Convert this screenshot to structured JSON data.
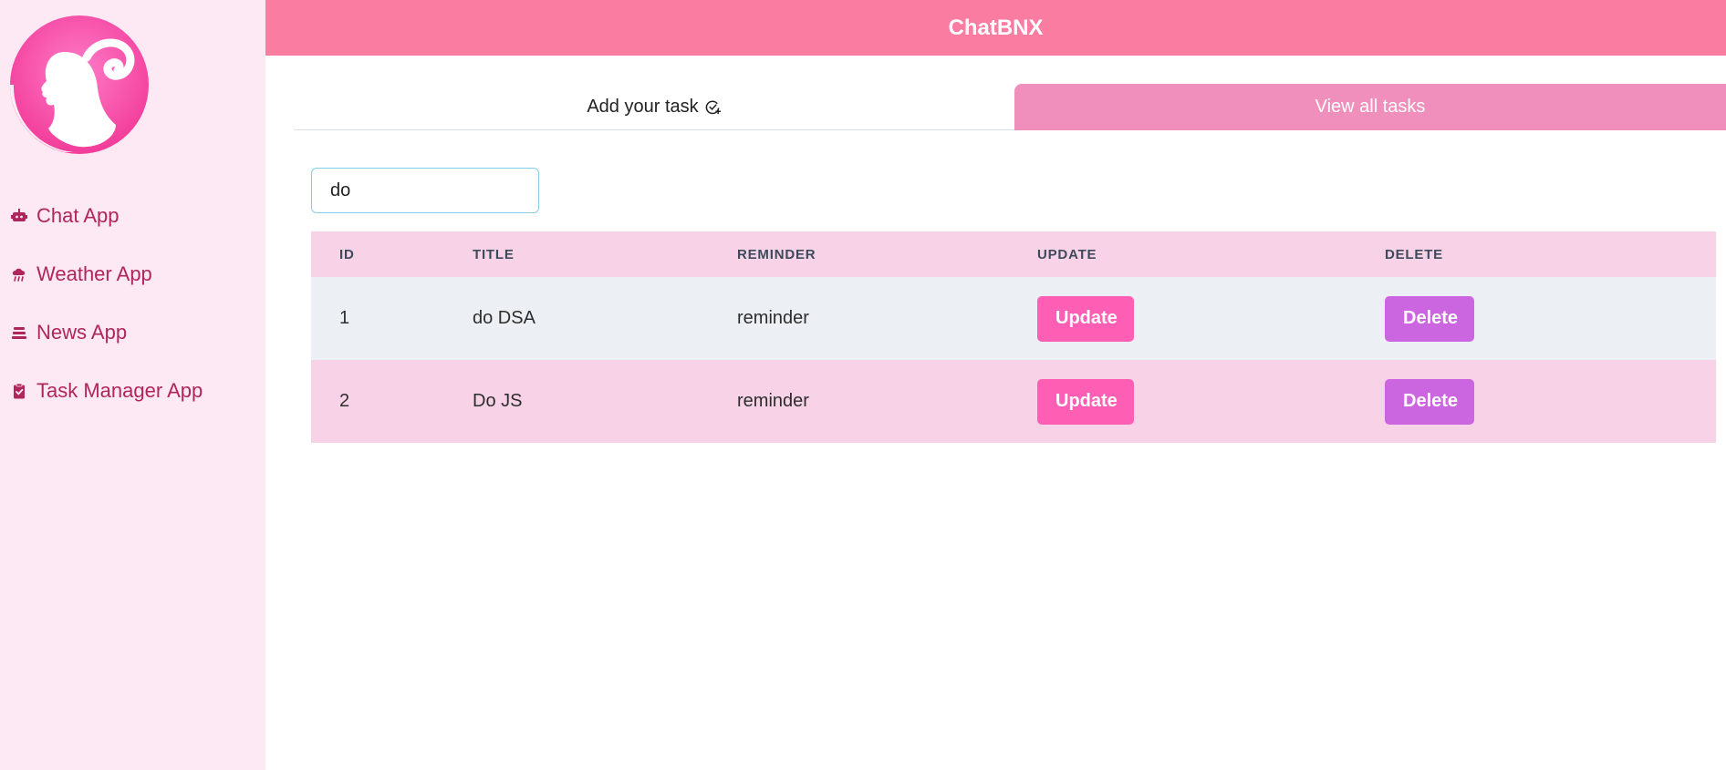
{
  "header": {
    "title": "ChatBNX"
  },
  "sidebar": {
    "items": [
      {
        "label": "Chat App",
        "icon": "robot-icon"
      },
      {
        "label": "Weather App",
        "icon": "cloud-rain-icon"
      },
      {
        "label": "News App",
        "icon": "layers-icon"
      },
      {
        "label": "Task Manager App",
        "icon": "clipboard-check-icon"
      }
    ]
  },
  "tabs": [
    {
      "label": "Add your task",
      "active": false,
      "icon": "check-plus-icon"
    },
    {
      "label": "View all tasks",
      "active": true
    }
  ],
  "search": {
    "value": "do"
  },
  "table": {
    "columns": [
      "ID",
      "TITLE",
      "REMINDER",
      "UPDATE",
      "DELETE"
    ],
    "rows": [
      {
        "id": "1",
        "title": "do DSA",
        "reminder": "reminder",
        "update": "Update",
        "delete": "Delete"
      },
      {
        "id": "2",
        "title": "Do JS",
        "reminder": "reminder",
        "update": "Update",
        "delete": "Delete"
      }
    ]
  },
  "colors": {
    "header": "#fb7ca1",
    "sidebar": "#fde9f4",
    "nav_text": "#b0255c",
    "tab_active": "#f08fbb",
    "update_button": "#ff5eb5",
    "delete_button": "#cc66e0"
  }
}
